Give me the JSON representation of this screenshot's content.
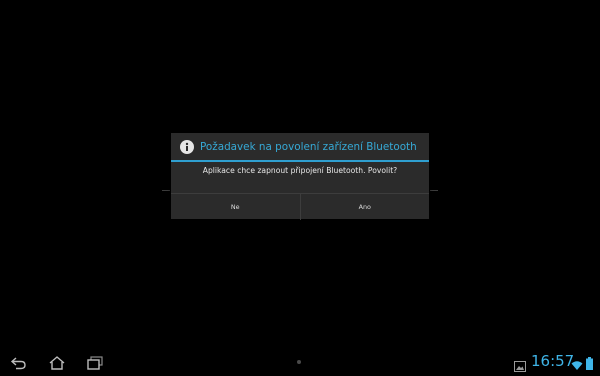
{
  "dialog": {
    "icon": "info-icon",
    "title": "Požadavek na povolení zařízení Bluetooth",
    "message": "Aplikace chce zapnout připojení Bluetooth. Povolit?",
    "negative_label": "Ne",
    "positive_label": "Ano",
    "accent_color": "#36a9d6"
  },
  "system_bar": {
    "nav_icons": [
      "back-icon",
      "home-icon",
      "recent-apps-icon"
    ],
    "status_icons": [
      "gallery-notification-icon",
      "wifi-icon",
      "battery-icon"
    ],
    "time": "16:57",
    "accent_color": "#3fb5e8"
  }
}
